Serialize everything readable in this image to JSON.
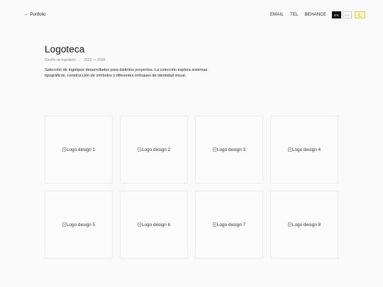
{
  "topbar": {
    "back_arrow": "←",
    "back_label": "Portfolio",
    "links": [
      "EMAIL",
      "TEL",
      "BEHANCE"
    ],
    "languages": [
      "ES",
      "EN"
    ],
    "active_language": "ES",
    "theme_icon": "moon-icon"
  },
  "header": {
    "title": "Logoteca",
    "category": "Diseño de logotipos",
    "years": "2022 — 2026",
    "description": "Selección de logotipos desarrollados para distintos proyectos. La colección explora sistemas tipográficos, construcción de símbolos y diferentes enfoques de identidad visual."
  },
  "gallery": {
    "items": [
      "Logo design 1",
      "Logo design 2",
      "Logo design 3",
      "Logo design 4",
      "Logo design 5",
      "Logo design 6",
      "Logo design 7",
      "Logo design 8"
    ]
  },
  "colors": {
    "background": "#fafafa",
    "accent_theme": "#e7c94a",
    "active_lang": "#111111"
  }
}
